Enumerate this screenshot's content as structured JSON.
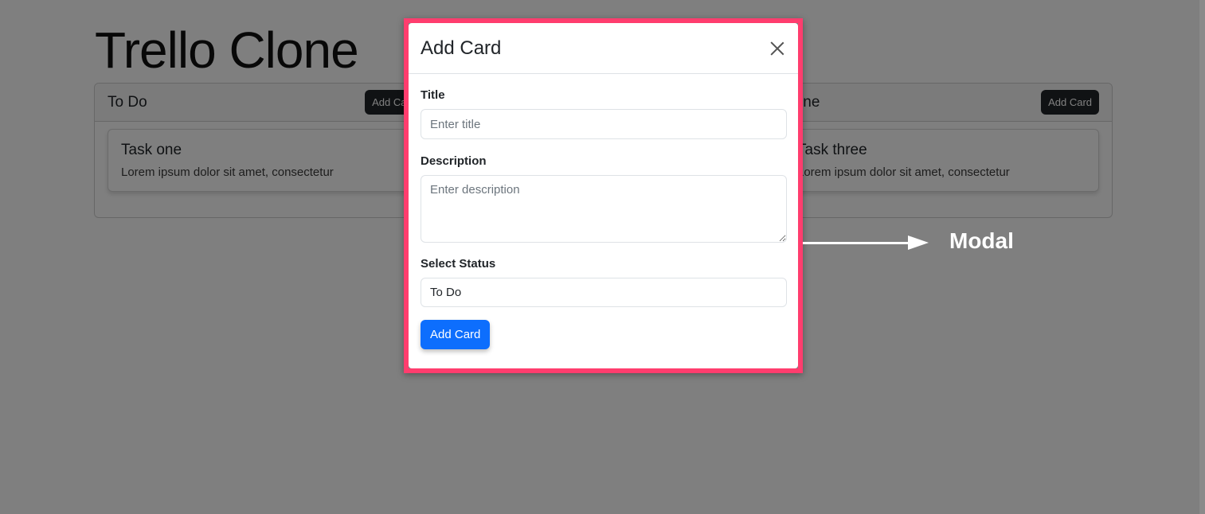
{
  "app": {
    "title": "Trello Clone"
  },
  "columns": [
    {
      "title": "To Do",
      "add_label": "Add Card",
      "cards": [
        {
          "title": "Task one",
          "text": "Lorem ipsum dolor sit amet, consectetur"
        }
      ]
    },
    {
      "title": "Done",
      "add_label": "Add Card",
      "cards": [
        {
          "title": "Task three",
          "text": "Lorem ipsum dolor sit amet, consectetur"
        }
      ]
    }
  ],
  "modal": {
    "title": "Add Card",
    "close_icon": "close-icon",
    "title_label": "Title",
    "title_placeholder": "Enter title",
    "description_label": "Description",
    "description_placeholder": "Enter description",
    "status_label": "Select Status",
    "status_value": "To Do",
    "submit_label": "Add Card"
  },
  "annotation": {
    "label": "Modal"
  },
  "colors": {
    "highlight": "#ff3d6e",
    "primary": "#0d6efd",
    "dark": "#212529"
  }
}
